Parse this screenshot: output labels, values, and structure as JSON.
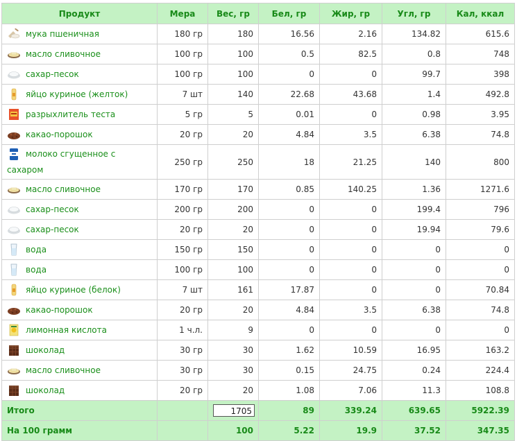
{
  "headers": [
    "Продукт",
    "Мера",
    "Вес, гр",
    "Бел, гр",
    "Жир, гр",
    "Угл, гр",
    "Кал, ккал"
  ],
  "rows": [
    {
      "icon": "flour-icon",
      "name": "мука пшеничная",
      "measure": "180 гр",
      "weight": "180",
      "protein": "16.56",
      "fat": "2.16",
      "carbs": "134.82",
      "kcal": "615.6"
    },
    {
      "icon": "butter-icon",
      "name": "масло сливочное",
      "measure": "100 гр",
      "weight": "100",
      "protein": "0.5",
      "fat": "82.5",
      "carbs": "0.8",
      "kcal": "748"
    },
    {
      "icon": "sugar-icon",
      "name": "сахар-песок",
      "measure": "100 гр",
      "weight": "100",
      "protein": "0",
      "fat": "0",
      "carbs": "99.7",
      "kcal": "398"
    },
    {
      "icon": "egg-icon",
      "name": "яйцо куриное (желток)",
      "measure": "7 шт",
      "weight": "140",
      "protein": "22.68",
      "fat": "43.68",
      "carbs": "1.4",
      "kcal": "492.8"
    },
    {
      "icon": "baking-powder-icon",
      "name": "разрыхлитель теста",
      "measure": "5 гр",
      "weight": "5",
      "protein": "0.01",
      "fat": "0",
      "carbs": "0.98",
      "kcal": "3.95"
    },
    {
      "icon": "cocoa-icon",
      "name": "какао-порошок",
      "measure": "20 гр",
      "weight": "20",
      "protein": "4.84",
      "fat": "3.5",
      "carbs": "6.38",
      "kcal": "74.8"
    },
    {
      "icon": "condensed-milk-icon",
      "name": "молоко сгущенное с сахаром",
      "measure": "250 гр",
      "weight": "250",
      "protein": "18",
      "fat": "21.25",
      "carbs": "140",
      "kcal": "800",
      "tall": true
    },
    {
      "icon": "butter-icon",
      "name": "масло сливочное",
      "measure": "170 гр",
      "weight": "170",
      "protein": "0.85",
      "fat": "140.25",
      "carbs": "1.36",
      "kcal": "1271.6"
    },
    {
      "icon": "sugar-icon",
      "name": "сахар-песок",
      "measure": "200 гр",
      "weight": "200",
      "protein": "0",
      "fat": "0",
      "carbs": "199.4",
      "kcal": "796"
    },
    {
      "icon": "sugar-icon",
      "name": "сахар-песок",
      "measure": "20 гр",
      "weight": "20",
      "protein": "0",
      "fat": "0",
      "carbs": "19.94",
      "kcal": "79.6"
    },
    {
      "icon": "water-glass-icon",
      "name": "вода",
      "measure": "150 гр",
      "weight": "150",
      "protein": "0",
      "fat": "0",
      "carbs": "0",
      "kcal": "0"
    },
    {
      "icon": "water-glass-icon",
      "name": "вода",
      "measure": "100 гр",
      "weight": "100",
      "protein": "0",
      "fat": "0",
      "carbs": "0",
      "kcal": "0"
    },
    {
      "icon": "egg-icon",
      "name": "яйцо куриное (белок)",
      "measure": "7 шт",
      "weight": "161",
      "protein": "17.87",
      "fat": "0",
      "carbs": "0",
      "kcal": "70.84"
    },
    {
      "icon": "cocoa-icon",
      "name": "какао-порошок",
      "measure": "20 гр",
      "weight": "20",
      "protein": "4.84",
      "fat": "3.5",
      "carbs": "6.38",
      "kcal": "74.8"
    },
    {
      "icon": "citric-acid-icon",
      "name": "лимонная кислота",
      "measure": "1 ч.л.",
      "weight": "9",
      "protein": "0",
      "fat": "0",
      "carbs": "0",
      "kcal": "0"
    },
    {
      "icon": "chocolate-icon",
      "name": "шоколад",
      "measure": "30 гр",
      "weight": "30",
      "protein": "1.62",
      "fat": "10.59",
      "carbs": "16.95",
      "kcal": "163.2"
    },
    {
      "icon": "butter-icon",
      "name": "масло сливочное",
      "measure": "30 гр",
      "weight": "30",
      "protein": "0.15",
      "fat": "24.75",
      "carbs": "0.24",
      "kcal": "224.4"
    },
    {
      "icon": "chocolate-icon",
      "name": "шоколад",
      "measure": "20 гр",
      "weight": "20",
      "protein": "1.08",
      "fat": "7.06",
      "carbs": "11.3",
      "kcal": "108.8"
    }
  ],
  "total": {
    "label": "Итого",
    "weight_input": "1705",
    "protein": "89",
    "fat": "339.24",
    "carbs": "639.65",
    "kcal": "5922.39"
  },
  "per100": {
    "label": "На 100 грамм",
    "weight": "100",
    "protein": "5.22",
    "fat": "19.9",
    "carbs": "37.52",
    "kcal": "347.35"
  },
  "colors": {
    "header_bg": "#c4f2c4",
    "header_text": "#188a18",
    "link_text": "#1a8f1a",
    "border": "#cfcfcf"
  }
}
